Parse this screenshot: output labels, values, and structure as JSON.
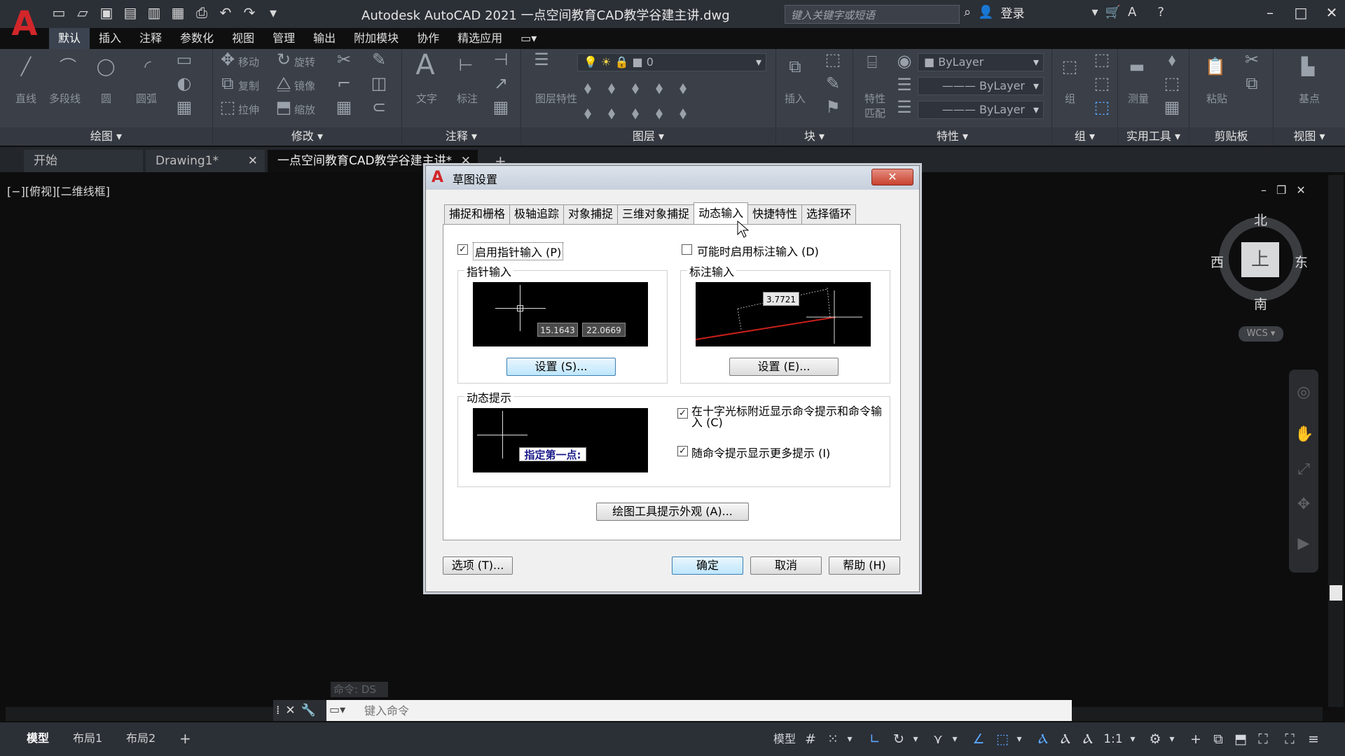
{
  "window": {
    "title": "Autodesk AutoCAD 2021    一点空间教育CAD教学谷建主讲.dwg",
    "search_placeholder": "键入关键字或短语",
    "login": "登录"
  },
  "ribbon_tabs": [
    "默认",
    "插入",
    "注释",
    "参数化",
    "视图",
    "管理",
    "输出",
    "附加模块",
    "协作",
    "精选应用"
  ],
  "ribbon": {
    "draw": {
      "title": "绘图",
      "tools": [
        "直线",
        "多段线",
        "圆",
        "圆弧"
      ]
    },
    "modify": {
      "title": "修改",
      "tools": [
        "移动",
        "旋转",
        "复制",
        "镜像",
        "拉伸",
        "缩放"
      ]
    },
    "annotation": {
      "title": "注释",
      "tools": [
        "文字",
        "标注"
      ]
    },
    "layers": {
      "title": "图层",
      "tools": [
        "图层特性"
      ],
      "current_layer": "0"
    },
    "block": {
      "title": "块",
      "tools": [
        "插入"
      ]
    },
    "properties": {
      "title": "特性",
      "tools": [
        "特性匹配"
      ],
      "color": "ByLayer",
      "linetype": "ByLayer",
      "lineweight": "ByLayer"
    },
    "groups": {
      "title": "组",
      "tools": [
        "组"
      ]
    },
    "utilities": {
      "title": "实用工具",
      "tools": [
        "测量"
      ]
    },
    "clipboard": {
      "title": "剪贴板",
      "tools": [
        "粘贴"
      ]
    },
    "view": {
      "title": "视图",
      "tools": [
        "基点"
      ]
    }
  },
  "doc_tabs": [
    {
      "label": "开始"
    },
    {
      "label": "Drawing1*"
    },
    {
      "label": "一点空间教育CAD教学谷建主讲*"
    }
  ],
  "viewport": {
    "label": "[−][俯视][二维线框]",
    "compass": {
      "north": "北",
      "south": "南",
      "east": "东",
      "west": "西",
      "top": "上"
    },
    "wcs": "WCS"
  },
  "command": {
    "history": "命令: DS",
    "placeholder": "键入命令"
  },
  "layout_tabs": [
    "模型",
    "布局1",
    "布局2"
  ],
  "status": {
    "model": "模型",
    "scale": "1:1"
  },
  "dialog": {
    "title": "草图设置",
    "close": "✕",
    "tabs": [
      "捕捉和栅格",
      "极轴追踪",
      "对象捕捉",
      "三维对象捕捉",
      "动态输入",
      "快捷特性",
      "选择循环"
    ],
    "active_tab": 4,
    "enable_pointer": "启用指针输入 (P)",
    "enable_dimension": "可能时启用标注输入 (D)",
    "pointer_group": "指针输入",
    "pointer_values": [
      "15.1643",
      "22.0669"
    ],
    "pointer_settings": "设置 (S)...",
    "dim_group": "标注输入",
    "dim_value": "3.7721",
    "dim_settings": "设置 (E)...",
    "prompt_group": "动态提示",
    "prompt_text": "指定第一点:",
    "show_cmd_prompt": "在十字光标附近显示命令提示和命令输入 (C)",
    "show_more": "随命令提示显示更多提示 (I)",
    "appearance": "绘图工具提示外观 (A)...",
    "options": "选项 (T)...",
    "ok": "确定",
    "cancel": "取消",
    "help": "帮助 (H)"
  },
  "colors": {
    "accent": "#5aa7ff",
    "logo": "#d2262a",
    "dim_line": "#c8201a"
  }
}
